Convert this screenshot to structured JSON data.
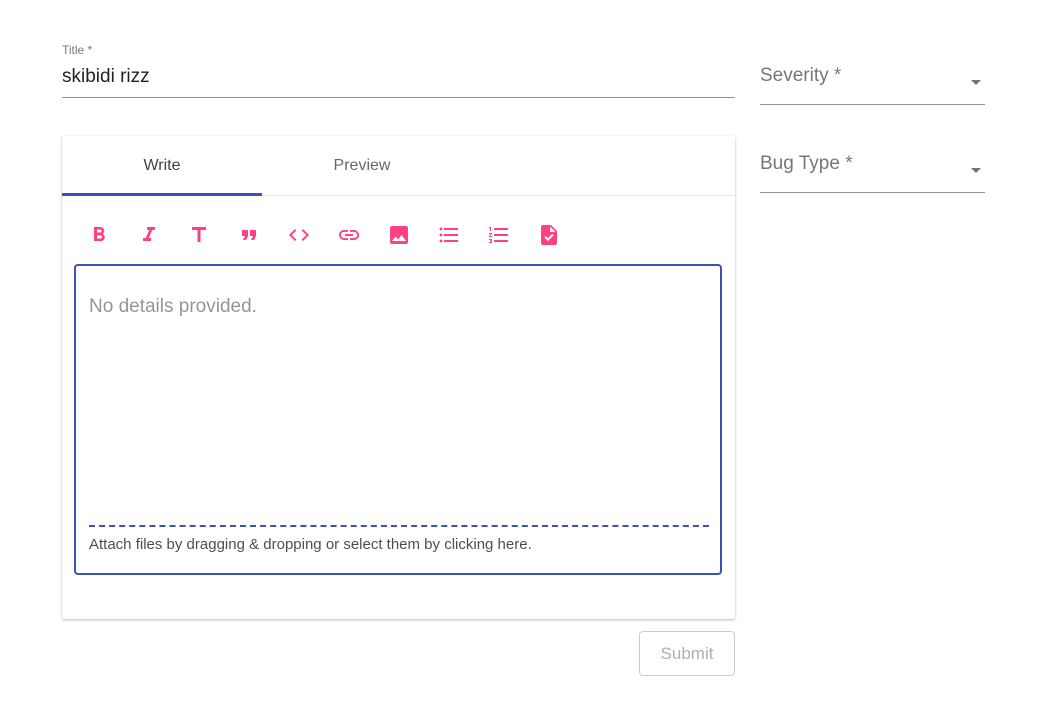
{
  "form": {
    "title_label": "Title *",
    "title_value": "skibidi rizz",
    "severity_label": "Severity *",
    "bug_type_label": "Bug Type *",
    "submit_label": "Submit"
  },
  "editor": {
    "tabs": [
      {
        "label": "Write",
        "active": true
      },
      {
        "label": "Preview",
        "active": false
      }
    ],
    "toolbar": [
      {
        "icon": "bold-icon",
        "title": "Add bold text"
      },
      {
        "icon": "italic-icon",
        "title": "Add italic text"
      },
      {
        "icon": "header-icon",
        "title": "Insert a header"
      },
      {
        "icon": "quote-icon",
        "title": "Insert a quote"
      },
      {
        "icon": "code-icon",
        "title": "Insert code"
      },
      {
        "icon": "link-icon",
        "title": "Add a link"
      },
      {
        "icon": "image-icon",
        "title": "Add image"
      },
      {
        "icon": "bulleted-list-icon",
        "title": "Add a bulleted list"
      },
      {
        "icon": "numbered-list-icon",
        "title": "Add a numbered list"
      },
      {
        "icon": "task-list-icon",
        "title": "Add a task list"
      }
    ],
    "placeholder": "No details provided.",
    "attach_hint": "Attach files by dragging & dropping or select them by clicking here."
  },
  "colors": {
    "primary": "#3f51b5",
    "accent": "#ff4081"
  }
}
